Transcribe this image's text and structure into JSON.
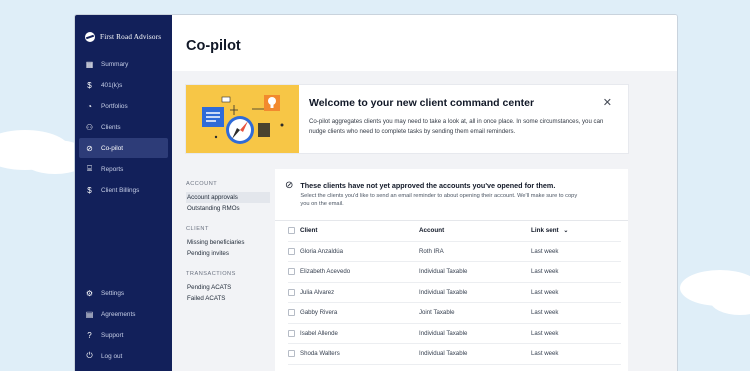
{
  "brand": {
    "name": "First Road Advisors"
  },
  "sidebar": {
    "items": [
      {
        "label": "Summary",
        "icon": "summary-icon",
        "glyph": "▦",
        "active": false
      },
      {
        "label": "401(k)s",
        "icon": "dollar-icon",
        "glyph": "$",
        "active": false
      },
      {
        "label": "Portfolios",
        "icon": "pie-chart-icon",
        "glyph": "◔",
        "active": false
      },
      {
        "label": "Clients",
        "icon": "users-icon",
        "glyph": "⚇",
        "active": false
      },
      {
        "label": "Co-pilot",
        "icon": "compass-icon",
        "glyph": "⊘",
        "active": true
      },
      {
        "label": "Reports",
        "icon": "report-icon",
        "glyph": "⌸",
        "active": false
      },
      {
        "label": "Client Billings",
        "icon": "billing-icon",
        "glyph": "$",
        "active": false
      }
    ],
    "bottom_items": [
      {
        "label": "Settings",
        "icon": "settings-icon",
        "glyph": "⚙"
      },
      {
        "label": "Agreements",
        "icon": "document-icon",
        "glyph": "▤"
      },
      {
        "label": "Support",
        "icon": "help-icon",
        "glyph": "?"
      },
      {
        "label": "Log out",
        "icon": "power-icon",
        "glyph": "⏻"
      }
    ]
  },
  "header": {
    "title": "Co-pilot"
  },
  "banner": {
    "title": "Welcome to your new client command center",
    "text": "Co-pilot aggregates clients you may need to take a look at, all in once place. In some circumstances, you can nudge clients who need to complete tasks by sending them email reminders.",
    "close_glyph": "✕"
  },
  "subnav": {
    "account": {
      "heading": "ACCOUNT",
      "items": [
        "Account approvals",
        "Outstanding RMOs"
      ]
    },
    "client": {
      "heading": "CLIENT",
      "items": [
        "Missing beneficiaries",
        "Pending invites"
      ]
    },
    "transactions": {
      "heading": "TRANSACTIONS",
      "items": [
        "Pending ACATS",
        "Failed ACATS"
      ]
    }
  },
  "panel": {
    "icon_glyph": "⊘",
    "title": "These clients have not yet approved the accounts you've opened for them.",
    "subtitle": "Select the clients you'd like to send an email reminder to about opening their account. We'll make sure to copy you on the email."
  },
  "table": {
    "headers": {
      "client": "Client",
      "account": "Account",
      "link_sent": "Link sent",
      "sort_glyph": "⌄"
    },
    "rows": [
      {
        "client": "Gloria Anzaldúa",
        "account": "Roth IRA",
        "link_sent": "Last week"
      },
      {
        "client": "Elizabeth Acevedo",
        "account": "Individual Taxable",
        "link_sent": "Last week"
      },
      {
        "client": "Julia Alvarez",
        "account": "Individual Taxable",
        "link_sent": "Last week"
      },
      {
        "client": "Gabby Rivera",
        "account": "Joint Taxable",
        "link_sent": "Last week"
      },
      {
        "client": "Isabel Allende",
        "account": "Individual Taxable",
        "link_sent": "Last week"
      },
      {
        "client": "Shoda Walters",
        "account": "Individual Taxable",
        "link_sent": "Last week"
      }
    ]
  },
  "colors": {
    "sidebar": "#12205a",
    "sidebar_active": "#2d3c78",
    "banner_art": "#f7c646",
    "accent_blue": "#2f6bd8",
    "page_bg": "#dfeef8"
  }
}
